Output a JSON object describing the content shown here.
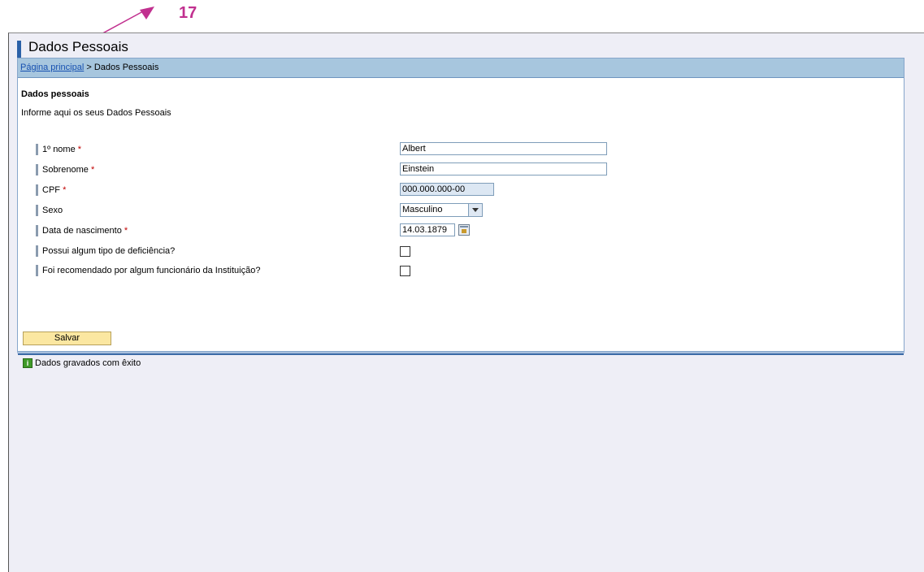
{
  "annotation": {
    "number": "17"
  },
  "header": {
    "title": "Dados Pessoais"
  },
  "breadcrumb": {
    "home": "Página principal",
    "separator": ">",
    "current": "Dados Pessoais"
  },
  "section": {
    "title": "Dados pessoais",
    "description": "Informe aqui os seus Dados Pessoais"
  },
  "form": {
    "required_marker": "*",
    "first_name": {
      "label": "1º nome",
      "value": "Albert"
    },
    "last_name": {
      "label": "Sobrenome",
      "value": "Einstein"
    },
    "cpf": {
      "label": "CPF",
      "value": "000.000.000-00"
    },
    "sex": {
      "label": "Sexo",
      "value": "Masculino"
    },
    "birth_date": {
      "label": "Data de nascimento",
      "value": "14.03.1879"
    },
    "disability": {
      "label": "Possui algum tipo de deficiência?",
      "checked": false
    },
    "recommended": {
      "label": "Foi recomendado por algum funcionário da Instituição?",
      "checked": false
    }
  },
  "actions": {
    "save_label": "Salvar"
  },
  "status": {
    "message": "Dados gravados com êxito",
    "icon": "info-icon"
  },
  "colors": {
    "accent": "#2b61a8",
    "breadcrumb_bg": "#a7c6de",
    "annotation": "#c1308f",
    "button": "#fbe7a1"
  }
}
